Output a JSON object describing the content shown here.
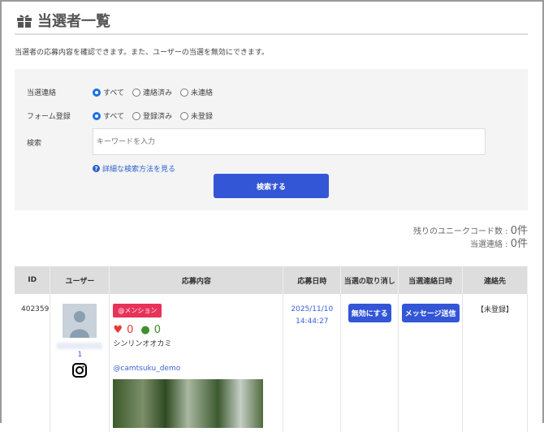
{
  "page": {
    "title": "当選者一覧",
    "description": "当選者の応募内容を確認できます。また、ユーザーの当選を無効にできます。"
  },
  "filters": {
    "contact": {
      "label": "当選連絡",
      "options": [
        "すべて",
        "連絡済み",
        "未連絡"
      ],
      "selected": "すべて"
    },
    "form": {
      "label": "フォーム登録",
      "options": [
        "すべて",
        "登録済み",
        "未登録"
      ],
      "selected": "すべて"
    },
    "search": {
      "label": "検索",
      "placeholder": "キーワードを入力",
      "value": ""
    },
    "help_link": "詳細な検索方法を見る",
    "search_button": "検索する"
  },
  "counts": {
    "unique_label": "残りのユニークコード数 : ",
    "unique_value": "0件",
    "contact_label": "当選連絡 : ",
    "contact_value": "0件"
  },
  "table": {
    "headers": [
      "ID",
      "ユーザー",
      "応募内容",
      "応募日時",
      "当選の取り消し",
      "当選連絡日時",
      "連絡先"
    ],
    "rows": [
      {
        "id": "402359",
        "user_tail": "1",
        "tag": "@メンション",
        "likes": "0",
        "comments": "0",
        "text": "シンリンオオカミ",
        "account": "@camtsuku_demo",
        "date": "2025/11/10",
        "time": "14:44:27",
        "cancel_button": "無効にする",
        "message_button": "メッセージ送信",
        "contact": "【未登録】"
      }
    ]
  }
}
